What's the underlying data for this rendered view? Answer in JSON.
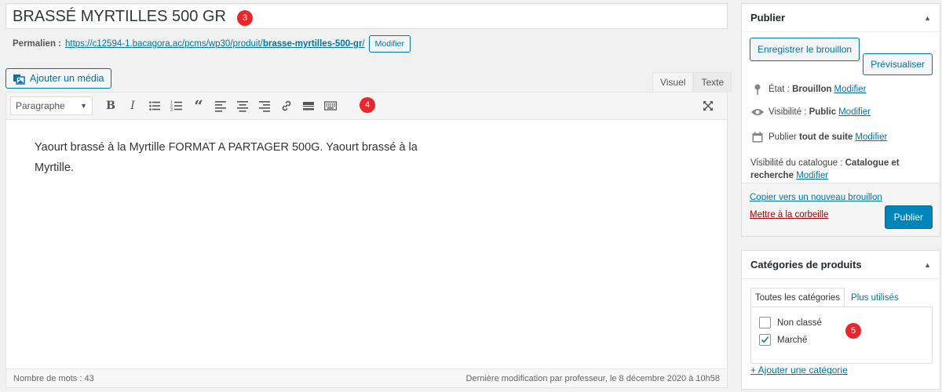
{
  "post": {
    "title": "BRASSÉ MYRTILLES 500 GR",
    "permalink_label": "Permalien :",
    "permalink_base": "https://c12594-1.bacagora.ac/pcms/wp30/produit/",
    "permalink_slug": "brasse-myrtilles-500-gr",
    "permalink_end": "/",
    "permalink_edit": "Modifier"
  },
  "badges": {
    "title": "3",
    "toolbar": "4",
    "categories": "5"
  },
  "editor": {
    "add_media": "Ajouter un média",
    "tab_visual": "Visuel",
    "tab_text": "Texte",
    "format": "Paragraphe",
    "content": "Yaourt brassé à la Myrtille FORMAT A PARTAGER 500G. Yaourt brassé à la Myrtille.",
    "word_count": "Nombre de mots : 43",
    "last_modified": "Dernière modification par professeur, le 8 décembre 2020 à 10h58"
  },
  "publish": {
    "title": "Publier",
    "save_draft": "Enregistrer le brouillon",
    "preview": "Prévisualiser",
    "status_label": "État :",
    "status_value": "Brouillon",
    "visibility_label": "Visibilité :",
    "visibility_value": "Public",
    "publish_label": "Publier",
    "publish_value": "tout de suite",
    "catalog_label": "Visibilité du catalogue :",
    "catalog_value": "Catalogue et recherche",
    "edit": "Modifier",
    "copy_draft": "Copier vers un nouveau brouillon",
    "trash": "Mettre à la corbeille",
    "publish_btn": "Publier"
  },
  "categories": {
    "title": "Catégories de produits",
    "tab_all": "Toutes les catégories",
    "tab_used": "Plus utilisés",
    "items": [
      {
        "label": "Non classé",
        "checked": false
      },
      {
        "label": "Marché",
        "checked": true
      }
    ],
    "add": "+ Ajouter une catégorie"
  },
  "colors": {
    "accent": "#0073aa",
    "primary": "#0085ba",
    "badge": "#e8262c",
    "trash": "#a00"
  }
}
